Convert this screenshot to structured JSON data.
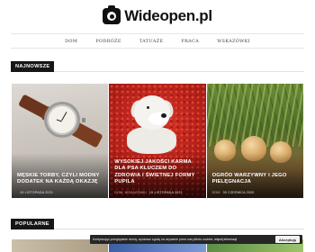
{
  "site": {
    "logo_text": "Wideopen.pl"
  },
  "nav": {
    "items": [
      {
        "label": "DOM"
      },
      {
        "label": "PODRÓŻE"
      },
      {
        "label": "TATUAŻE"
      },
      {
        "label": "PRACA"
      },
      {
        "label": "WSKAZÓWKI"
      }
    ]
  },
  "latest": {
    "heading": "NAJNOWSZE",
    "posts": [
      {
        "title": "MĘSKIE TORBY, CZYLI MODNY DODATEK NA KAŻDĄ OKAZJĘ",
        "category": "",
        "date": "15 LISTOPADA 2021",
        "image": "wristwatch-photo"
      },
      {
        "title": "WYSOKIEJ JAKOŚCI KARMA DLA PSA KLUCZEM DO ZDROWIA I ŚWIETNEJ FORMY PUPILA",
        "category": "DOM, WSKAZÓWKI",
        "date": "15 LISTOPADA 2021",
        "image": "white-dog-photo"
      },
      {
        "title": "OGRÓD WARZYWNY I JEGO PIELĘGNACJA",
        "category": "DOM",
        "date": "30 CZERWCA 2020",
        "image": "onions-garden-photo"
      }
    ]
  },
  "popular": {
    "heading": "POPULARNE"
  },
  "cookie": {
    "text": "Kontynuując przeglądanie strony, wyrażasz zgodę na używanie przez nas plików cookies.",
    "link": "więcej informacji",
    "accept": "Akceptuję"
  },
  "colors": {
    "label_bg": "#161616",
    "cookie_bg": "#262626",
    "category_text": "#e7a6a6"
  }
}
